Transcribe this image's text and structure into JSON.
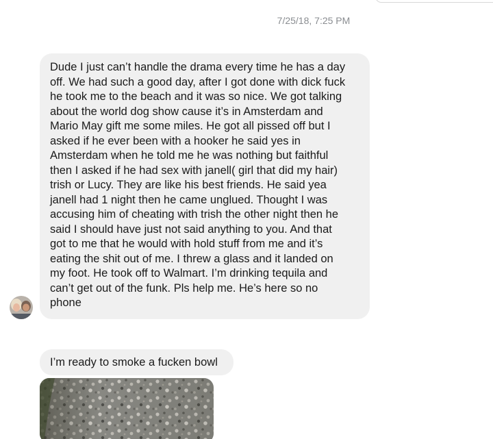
{
  "conversation": {
    "timestamp": "7/25/18, 7:25 PM",
    "messages": [
      {
        "text": "Dude I just can’t handle the drama every time he has a day\noff. We had such a good day, after I got done with dick fuck\nhe took me to the beach and it was so nice. We got talking\nabout the world dog show cause it’s in Amsterdam and\nMario May gift me some miles. He got all pissed off but I\nasked if he ever been with a hooker he said yes in\nAmsterdam when he told me he was nothing but faithful\nthen I asked if he had sex with janell( girl that did my hair)\ntrish or Lucy. They are like his best friends. He said yea\njanell had 1 night then he came unglued. Thought I was\naccusing him of cheating with trish the other night then he\nsaid I should have just not said anything to you. And that\ngot to me that he would with hold stuff from me and it’s\neating the shit out of me. I threw a glass and it landed on\nmy foot. He took off to Walmart. I’m drinking tequila and\ncan’t get out of the funk. Pls help me. He’s here so no\nphone"
      },
      {
        "text": "I’m ready to smoke a fucken bowl"
      }
    ]
  },
  "colors": {
    "bubble_background": "#f0f0f0",
    "timestamp_text": "#8a8d91",
    "message_text": "#1a1a1a"
  },
  "icons": {
    "sender_avatar": "avatar-photo-two-people",
    "attachment": "photo-gravel-ground"
  }
}
